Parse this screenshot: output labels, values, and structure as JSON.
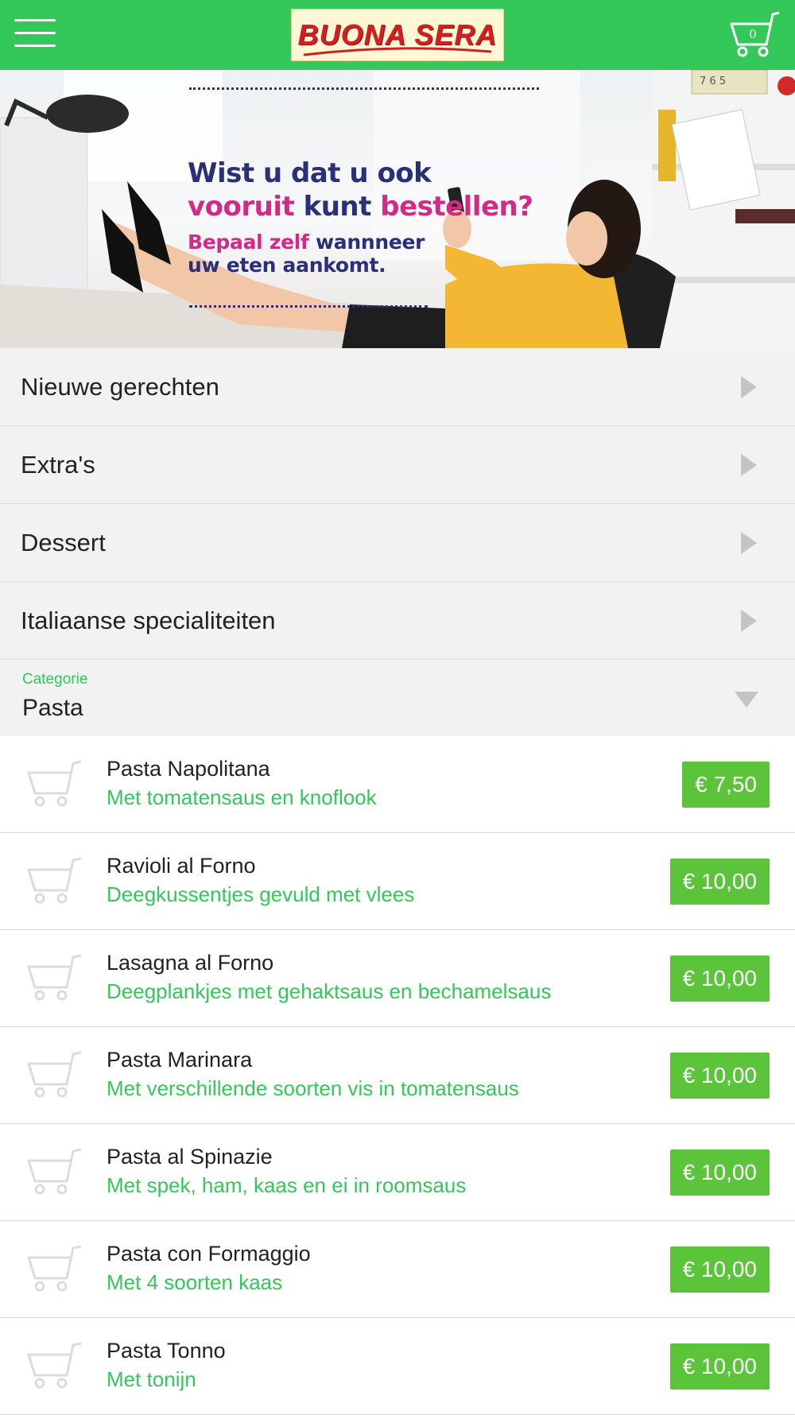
{
  "header": {
    "logo_text": "BUONA SERA",
    "cart_count": "0"
  },
  "banner": {
    "line1": "Wist u dat u ook",
    "line2_a": "vooruit",
    "line2_b": "kunt",
    "line2_c": "bestellen?",
    "line3_a": "Bepaal zelf",
    "line3_b": "wannneer",
    "line4": "uw eten aankomt.",
    "clock_digits": "7 6 5"
  },
  "categories": [
    {
      "label": "Nieuwe gerechten"
    },
    {
      "label": "Extra's"
    },
    {
      "label": "Dessert"
    },
    {
      "label": "Italiaanse specialiteiten"
    }
  ],
  "category_select": {
    "caption": "Categorie",
    "value": "Pasta"
  },
  "products": [
    {
      "name": "Pasta Napolitana",
      "description": "Met tomatensaus en knoflook",
      "price": "€ 7,50"
    },
    {
      "name": "Ravioli al Forno",
      "description": "Deegkussentjes gevuld met vlees",
      "price": "€ 10,00"
    },
    {
      "name": "Lasagna al Forno",
      "description": "Deegplankjes met gehaktsaus en bechamelsaus",
      "price": "€ 10,00"
    },
    {
      "name": "Pasta Marinara",
      "description": "Met verschillende soorten vis in tomatensaus",
      "price": "€ 10,00"
    },
    {
      "name": "Pasta al Spinazie",
      "description": "Met spek, ham, kaas en ei in roomsaus",
      "price": "€ 10,00"
    },
    {
      "name": "Pasta con Formaggio",
      "description": "Met 4 soorten kaas",
      "price": "€ 10,00"
    },
    {
      "name": "Pasta Tonno",
      "description": "Met tonijn",
      "price": "€ 10,00"
    }
  ],
  "colors": {
    "brand_green": "#34c759",
    "price_green": "#5bc43b",
    "banner_navy": "#2a2f7a",
    "banner_magenta": "#d12a87",
    "logo_red": "#d21f1f"
  },
  "icons": [
    "hamburger-icon",
    "cart-icon",
    "chevron-right-icon",
    "chevron-down-icon",
    "product-cart-icon"
  ]
}
